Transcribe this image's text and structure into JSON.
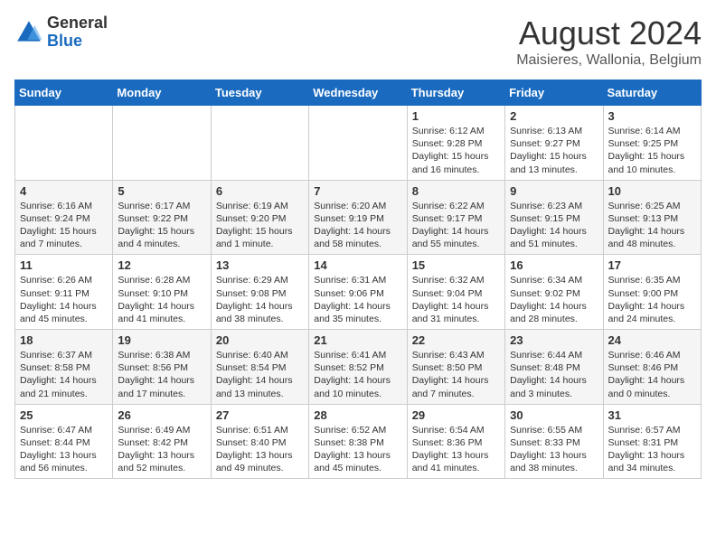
{
  "header": {
    "logo_general": "General",
    "logo_blue": "Blue",
    "month_year": "August 2024",
    "location": "Maisieres, Wallonia, Belgium"
  },
  "days_of_week": [
    "Sunday",
    "Monday",
    "Tuesday",
    "Wednesday",
    "Thursday",
    "Friday",
    "Saturday"
  ],
  "weeks": [
    [
      {
        "day": "",
        "info": ""
      },
      {
        "day": "",
        "info": ""
      },
      {
        "day": "",
        "info": ""
      },
      {
        "day": "",
        "info": ""
      },
      {
        "day": "1",
        "info": "Sunrise: 6:12 AM\nSunset: 9:28 PM\nDaylight: 15 hours and 16 minutes."
      },
      {
        "day": "2",
        "info": "Sunrise: 6:13 AM\nSunset: 9:27 PM\nDaylight: 15 hours and 13 minutes."
      },
      {
        "day": "3",
        "info": "Sunrise: 6:14 AM\nSunset: 9:25 PM\nDaylight: 15 hours and 10 minutes."
      }
    ],
    [
      {
        "day": "4",
        "info": "Sunrise: 6:16 AM\nSunset: 9:24 PM\nDaylight: 15 hours and 7 minutes."
      },
      {
        "day": "5",
        "info": "Sunrise: 6:17 AM\nSunset: 9:22 PM\nDaylight: 15 hours and 4 minutes."
      },
      {
        "day": "6",
        "info": "Sunrise: 6:19 AM\nSunset: 9:20 PM\nDaylight: 15 hours and 1 minute."
      },
      {
        "day": "7",
        "info": "Sunrise: 6:20 AM\nSunset: 9:19 PM\nDaylight: 14 hours and 58 minutes."
      },
      {
        "day": "8",
        "info": "Sunrise: 6:22 AM\nSunset: 9:17 PM\nDaylight: 14 hours and 55 minutes."
      },
      {
        "day": "9",
        "info": "Sunrise: 6:23 AM\nSunset: 9:15 PM\nDaylight: 14 hours and 51 minutes."
      },
      {
        "day": "10",
        "info": "Sunrise: 6:25 AM\nSunset: 9:13 PM\nDaylight: 14 hours and 48 minutes."
      }
    ],
    [
      {
        "day": "11",
        "info": "Sunrise: 6:26 AM\nSunset: 9:11 PM\nDaylight: 14 hours and 45 minutes."
      },
      {
        "day": "12",
        "info": "Sunrise: 6:28 AM\nSunset: 9:10 PM\nDaylight: 14 hours and 41 minutes."
      },
      {
        "day": "13",
        "info": "Sunrise: 6:29 AM\nSunset: 9:08 PM\nDaylight: 14 hours and 38 minutes."
      },
      {
        "day": "14",
        "info": "Sunrise: 6:31 AM\nSunset: 9:06 PM\nDaylight: 14 hours and 35 minutes."
      },
      {
        "day": "15",
        "info": "Sunrise: 6:32 AM\nSunset: 9:04 PM\nDaylight: 14 hours and 31 minutes."
      },
      {
        "day": "16",
        "info": "Sunrise: 6:34 AM\nSunset: 9:02 PM\nDaylight: 14 hours and 28 minutes."
      },
      {
        "day": "17",
        "info": "Sunrise: 6:35 AM\nSunset: 9:00 PM\nDaylight: 14 hours and 24 minutes."
      }
    ],
    [
      {
        "day": "18",
        "info": "Sunrise: 6:37 AM\nSunset: 8:58 PM\nDaylight: 14 hours and 21 minutes."
      },
      {
        "day": "19",
        "info": "Sunrise: 6:38 AM\nSunset: 8:56 PM\nDaylight: 14 hours and 17 minutes."
      },
      {
        "day": "20",
        "info": "Sunrise: 6:40 AM\nSunset: 8:54 PM\nDaylight: 14 hours and 13 minutes."
      },
      {
        "day": "21",
        "info": "Sunrise: 6:41 AM\nSunset: 8:52 PM\nDaylight: 14 hours and 10 minutes."
      },
      {
        "day": "22",
        "info": "Sunrise: 6:43 AM\nSunset: 8:50 PM\nDaylight: 14 hours and 7 minutes."
      },
      {
        "day": "23",
        "info": "Sunrise: 6:44 AM\nSunset: 8:48 PM\nDaylight: 14 hours and 3 minutes."
      },
      {
        "day": "24",
        "info": "Sunrise: 6:46 AM\nSunset: 8:46 PM\nDaylight: 14 hours and 0 minutes."
      }
    ],
    [
      {
        "day": "25",
        "info": "Sunrise: 6:47 AM\nSunset: 8:44 PM\nDaylight: 13 hours and 56 minutes."
      },
      {
        "day": "26",
        "info": "Sunrise: 6:49 AM\nSunset: 8:42 PM\nDaylight: 13 hours and 52 minutes."
      },
      {
        "day": "27",
        "info": "Sunrise: 6:51 AM\nSunset: 8:40 PM\nDaylight: 13 hours and 49 minutes."
      },
      {
        "day": "28",
        "info": "Sunrise: 6:52 AM\nSunset: 8:38 PM\nDaylight: 13 hours and 45 minutes."
      },
      {
        "day": "29",
        "info": "Sunrise: 6:54 AM\nSunset: 8:36 PM\nDaylight: 13 hours and 41 minutes."
      },
      {
        "day": "30",
        "info": "Sunrise: 6:55 AM\nSunset: 8:33 PM\nDaylight: 13 hours and 38 minutes."
      },
      {
        "day": "31",
        "info": "Sunrise: 6:57 AM\nSunset: 8:31 PM\nDaylight: 13 hours and 34 minutes."
      }
    ]
  ]
}
